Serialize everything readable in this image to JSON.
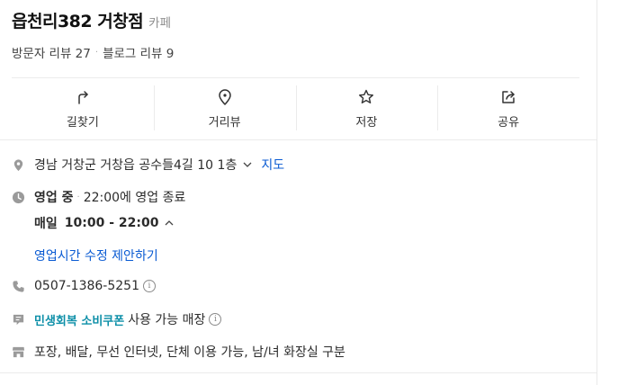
{
  "place": {
    "name": "읍천리382 거창점",
    "category": "카페",
    "visitor_review_label": "방문자 리뷰 27",
    "blog_review_label": "블로그 리뷰 9"
  },
  "actions": [
    {
      "label": "길찾기",
      "icon": "directions-icon"
    },
    {
      "label": "거리뷰",
      "icon": "location-pin-icon"
    },
    {
      "label": "저장",
      "icon": "star-icon"
    },
    {
      "label": "공유",
      "icon": "share-icon"
    }
  ],
  "address": {
    "text": "경남 거창군 거창읍 공수들4길 10 1층",
    "map_link": "지도"
  },
  "hours": {
    "status": "영업 중",
    "status_detail": "22:00에 영업 종료",
    "day_label": "매일",
    "range": "10:00 - 22:00",
    "suggest_edit": "영업시간 수정 제안하기"
  },
  "phone": "0507-1386-5251",
  "coupon": {
    "badge": "민생회복 소비쿠폰",
    "text": "사용 가능 매장"
  },
  "amenities": "포장, 배달, 무선 인터넷, 단체 이용 가능, 남/녀 화장실 구분",
  "colors": {
    "link": "#0a5bd3",
    "coupon": "#0d8fa8",
    "icon_gray": "#9a9a9a"
  }
}
